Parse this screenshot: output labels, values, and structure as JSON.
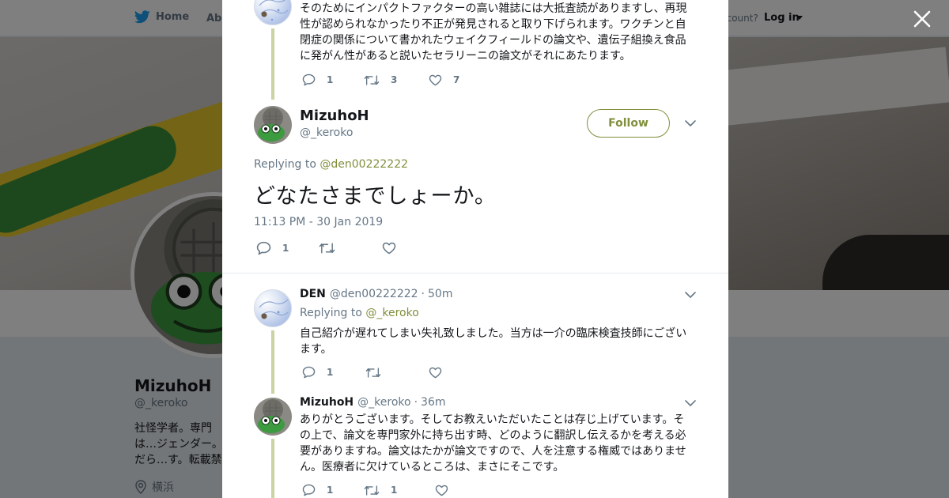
{
  "nav": {
    "home_label": "Home",
    "about_label": "Abo",
    "account_prompt": "ccount?",
    "login_label": "Log in"
  },
  "profile": {
    "name": "MizuhoH",
    "handle": "@_keroko",
    "bio": "社怪学者。専門は…ジェンダー。だら…す。転載禁止。",
    "location": "横浜"
  },
  "modal": {
    "prev_tweet": {
      "text": "そのためにインパクトファクターの高い雑誌には大抵査読がありますし、再現性が認められなかったり不正が発見されると取り下げられます。ワクチンと自閉症の関係について書かれたウェイクフィールドの論文や、遺伝子組換え食品に発がん性があると説いたセラリーニの論文がそれにあたります。",
      "reply_count": "1",
      "retweet_count": "3",
      "like_count": "7"
    },
    "main_tweet": {
      "name": "MizuhoH",
      "handle": "@_keroko",
      "follow_label": "Follow",
      "replying_prefix": "Replying to",
      "replying_to": "@den00222222",
      "text": "どなたさまでしょーか。",
      "timestamp": "11:13 PM - 30 Jan 2019",
      "reply_count": "1"
    },
    "replies": [
      {
        "name": "DEN",
        "handle": "@den00222222",
        "dot": "·",
        "time": "50m",
        "replying_prefix": "Replying to",
        "replying_to": "@_keroko",
        "text": "自己紹介が遅れてしまい失礼致しました。当方は一介の臨床検査技師にございます。",
        "reply_count": "1"
      },
      {
        "name": "MizuhoH",
        "handle": "@_keroko",
        "dot": "·",
        "time": "36m",
        "text": "ありがとうございます。そしてお教えいただいたことは存じ上げています。その上で、論文を専門家外に持ち出す時、どのように翻訳し伝えるかを考える必要がありますね。論文はたかが論文ですので、人を注意する権威ではありません。医療者に欠けているところは、まさにそこです。",
        "reply_count": "1",
        "retweet_count": "1"
      }
    ]
  },
  "colors": {
    "accent": "#7f8f3b",
    "thread_line": "#c9d3a3",
    "secondary_text": "#657786"
  }
}
